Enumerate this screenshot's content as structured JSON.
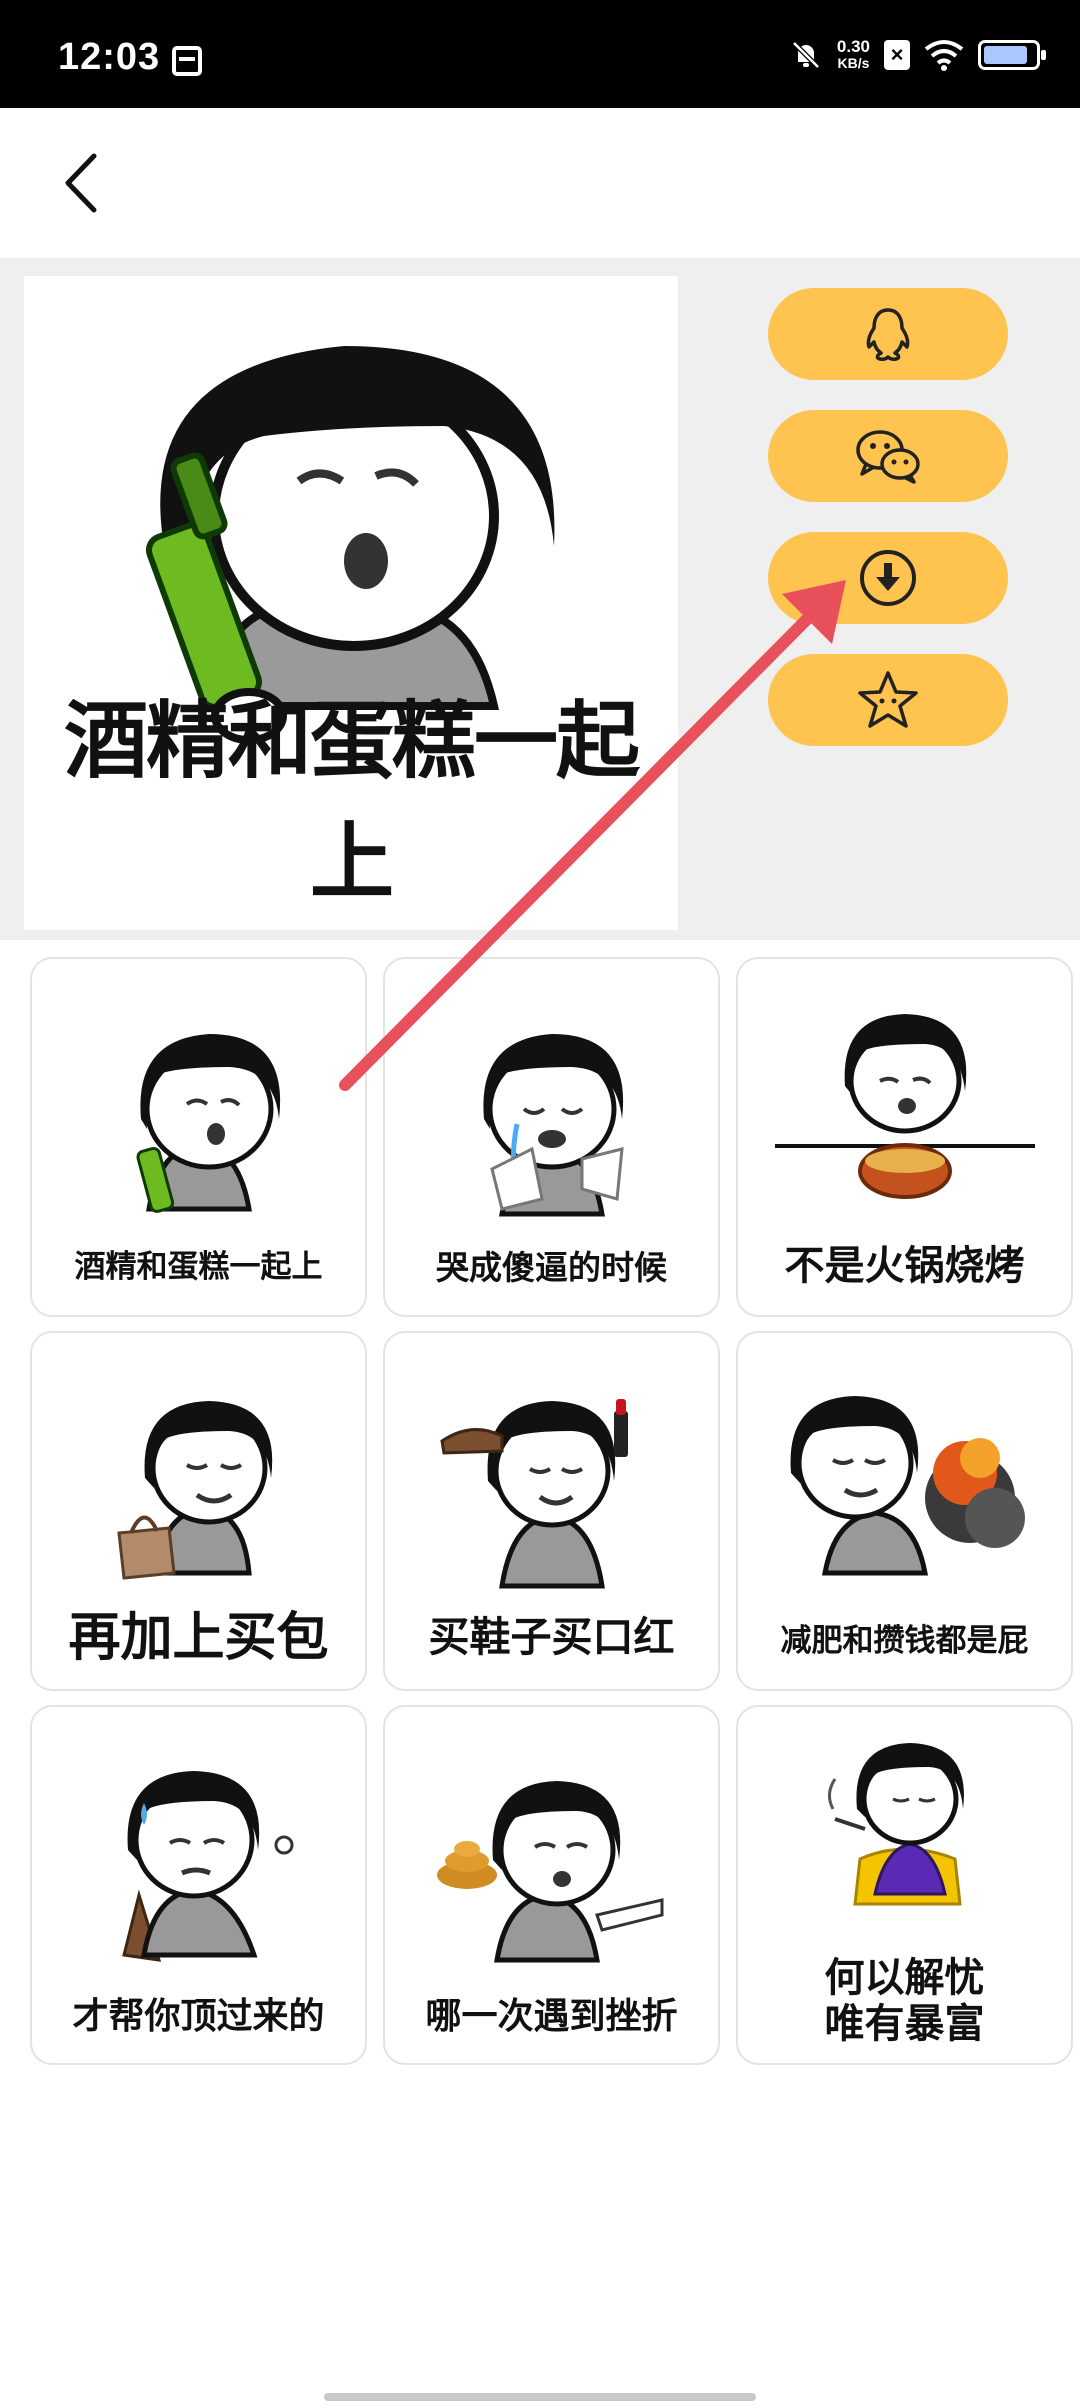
{
  "status_bar": {
    "time": "12:03",
    "net_speed_value": "0.30",
    "net_speed_unit": "KB/s",
    "battery_level": 0.85
  },
  "header": {
    "back_icon": "chevron-left-icon"
  },
  "preview": {
    "caption": "酒精和蛋糕一起上",
    "actions": [
      {
        "id": "qq",
        "icon": "qq-penguin-icon"
      },
      {
        "id": "wechat",
        "icon": "wechat-icon"
      },
      {
        "id": "download",
        "icon": "download-icon"
      },
      {
        "id": "favorite",
        "icon": "star-icon"
      }
    ],
    "accent_color": "#fec44f"
  },
  "grid": {
    "items": [
      {
        "caption": "酒精和蛋糕一起上"
      },
      {
        "caption": "哭成傻逼的时候"
      },
      {
        "caption": "不是火锅烧烤"
      },
      {
        "caption": "再加上买包"
      },
      {
        "caption": "买鞋子买口红"
      },
      {
        "caption": "减肥和攒钱都是屁"
      },
      {
        "caption": "才帮你顶过来的"
      },
      {
        "caption": "哪一次遇到挫折"
      },
      {
        "caption": "何以解忧"
      },
      {
        "caption_line2": "唯有暴富"
      }
    ]
  },
  "annotation": {
    "arrow_color": "#e8505b"
  }
}
